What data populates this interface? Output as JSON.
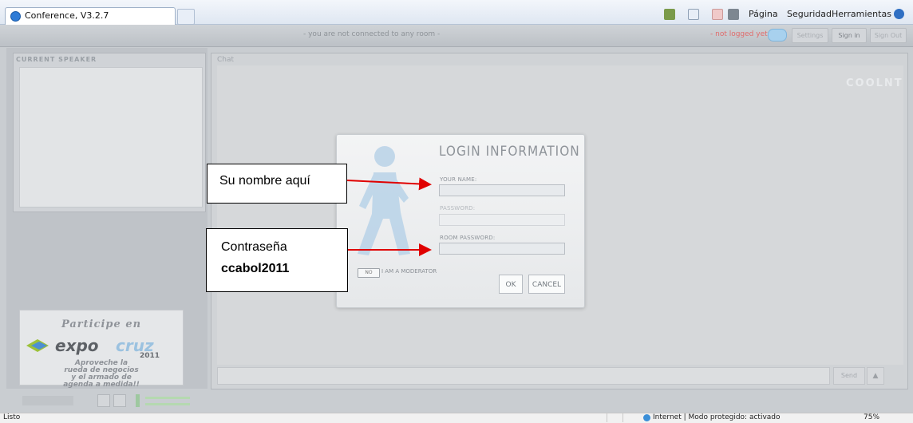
{
  "browser": {
    "tab_title": "Conference, V3.2.7",
    "commands": {
      "page": "Página",
      "security": "Seguridad",
      "tools": "Herramientas"
    },
    "status_left": "Listo",
    "status_zone": "Internet | Modo protegido: activado",
    "zoom": "75%"
  },
  "app": {
    "connection_status": "- you are not connected to any room -",
    "login_status": "- not logged yet -",
    "header_buttons": [
      "Settings",
      "Sign in",
      "Sign Out"
    ],
    "current_speaker_title": "CURRENT SPEAKER",
    "chat_title": "Chat",
    "chat_logo": "COOLNT",
    "send_label": "Send",
    "ad": {
      "line1": "Participe en",
      "logo_part1": "expo",
      "logo_part2": "cruz",
      "year": "2011",
      "line2": "Aproveche la",
      "line3": "rueda de negocios",
      "line4": "y el armado de",
      "line5": "agenda a medida!!"
    }
  },
  "login": {
    "title": "LOGIN INFORMATION",
    "your_name_label": "YOUR NAME:",
    "your_name_value": "",
    "password_label": "PASSWORD:",
    "password_value": "",
    "room_password_label": "ROOM PASSWORD:",
    "room_password_value": "",
    "moderator_toggle": "NO",
    "moderator_label": "I AM A MODERATOR",
    "ok_label": "OK",
    "cancel_label": "CANCEL"
  },
  "callouts": {
    "name_hint": "Su nombre aquí",
    "password_hint": "Contraseña",
    "password_value": "ccabol2011"
  },
  "colors": {
    "arrow": "#e00000",
    "brand_blue": "#9bc2e0"
  }
}
